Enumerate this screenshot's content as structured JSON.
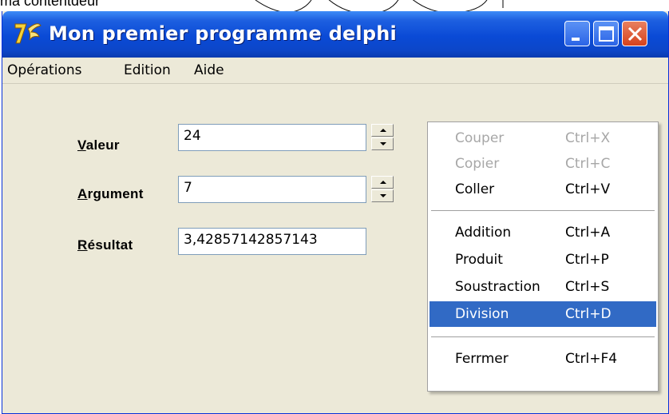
{
  "background": {
    "partial_text": "ma contentdeur"
  },
  "window": {
    "title": "Mon premier programme delphi",
    "accent": "#0a4ad6",
    "icons": {
      "app": "delphi-logo-icon",
      "minimize": "minimize-icon",
      "maximize": "maximize-icon",
      "close": "close-icon"
    }
  },
  "menubar": {
    "items": [
      "Opérations",
      "Edition",
      "Aide"
    ]
  },
  "form": {
    "valeur": {
      "label_u": "V",
      "label_rest": "aleur",
      "value": "24"
    },
    "argument": {
      "label_u": "A",
      "label_rest": "rgument",
      "value": "7"
    },
    "resultat": {
      "label_u": "R",
      "label_rest": "ésultat",
      "value": "3,42857142857143"
    }
  },
  "context_menu": {
    "items": [
      {
        "label": "Couper",
        "shortcut": "Ctrl+X"
      },
      {
        "label": "Copier",
        "shortcut": "Ctrl+C"
      },
      {
        "label": "Coller",
        "shortcut": "Ctrl+V"
      },
      {
        "label": "Addition",
        "shortcut": "Ctrl+A"
      },
      {
        "label": "Produit",
        "shortcut": "Ctrl+P"
      },
      {
        "label": "Soustraction",
        "shortcut": "Ctrl+S"
      },
      {
        "label": "Division",
        "shortcut": "Ctrl+D"
      },
      {
        "label": "Ferrmer",
        "shortcut": "Ctrl+F4"
      }
    ],
    "selected_label": "Division",
    "selected_color": "#316ac5"
  }
}
